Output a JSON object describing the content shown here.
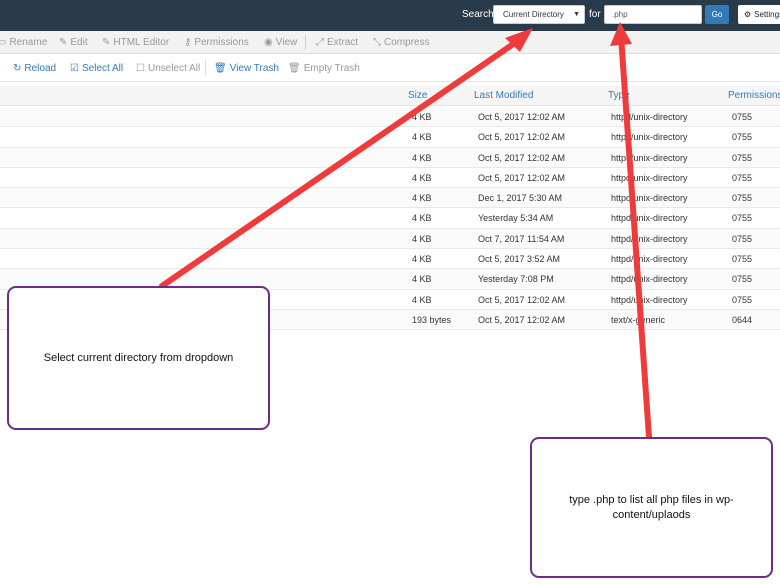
{
  "search": {
    "label": "Search",
    "scope_value": "Current Directory",
    "for_label": "for",
    "query_value": ".php",
    "go_label": "Go",
    "settings_label": "Settings"
  },
  "toolbar": {
    "items": [
      "Rename",
      "Edit",
      "HTML Editor",
      "Permissions",
      "View",
      "Extract",
      "Compress"
    ]
  },
  "actions": {
    "reload": "Reload",
    "select_all": "Select All",
    "unselect_all": "Unselect All",
    "view_trash": "View Trash",
    "empty_trash": "Empty Trash"
  },
  "table": {
    "headers": {
      "size": "Size",
      "modified": "Last Modified",
      "type": "Type",
      "permissions": "Permissions"
    },
    "rows": [
      {
        "size": "4 KB",
        "modified": "Oct 5, 2017 12:02 AM",
        "type": "httpd/unix-directory",
        "perm": "0755"
      },
      {
        "size": "4 KB",
        "modified": "Oct 5, 2017 12:02 AM",
        "type": "httpd/unix-directory",
        "perm": "0755"
      },
      {
        "size": "4 KB",
        "modified": "Oct 5, 2017 12:02 AM",
        "type": "httpd/unix-directory",
        "perm": "0755"
      },
      {
        "size": "4 KB",
        "modified": "Oct 5, 2017 12:02 AM",
        "type": "httpd/unix-directory",
        "perm": "0755"
      },
      {
        "size": "4 KB",
        "modified": "Dec 1, 2017 5:30 AM",
        "type": "httpd/unix-directory",
        "perm": "0755"
      },
      {
        "size": "4 KB",
        "modified": "Yesterday 5:34 AM",
        "type": "httpd/unix-directory",
        "perm": "0755"
      },
      {
        "size": "4 KB",
        "modified": "Oct 7, 2017 11:54 AM",
        "type": "httpd/unix-directory",
        "perm": "0755"
      },
      {
        "size": "4 KB",
        "modified": "Oct 5, 2017 3:52 AM",
        "type": "httpd/unix-directory",
        "perm": "0755"
      },
      {
        "size": "4 KB",
        "modified": "Yesterday 7:08 PM",
        "type": "httpd/unix-directory",
        "perm": "0755"
      },
      {
        "size": "4 KB",
        "modified": "Oct 5, 2017 12:02 AM",
        "type": "httpd/unix-directory",
        "perm": "0755"
      },
      {
        "size": "193 bytes",
        "modified": "Oct 5, 2017 12:02 AM",
        "type": "text/x-generic",
        "perm": "0644"
      }
    ]
  },
  "callouts": {
    "left": "Select current directory from dropdown",
    "right": "type .php to list all php files in wp-content/uplaods"
  },
  "colors": {
    "topbar": "#293a4a",
    "link": "#337ab7",
    "arrow": "#ef3b3b",
    "callout_border": "#6b2d8a"
  }
}
